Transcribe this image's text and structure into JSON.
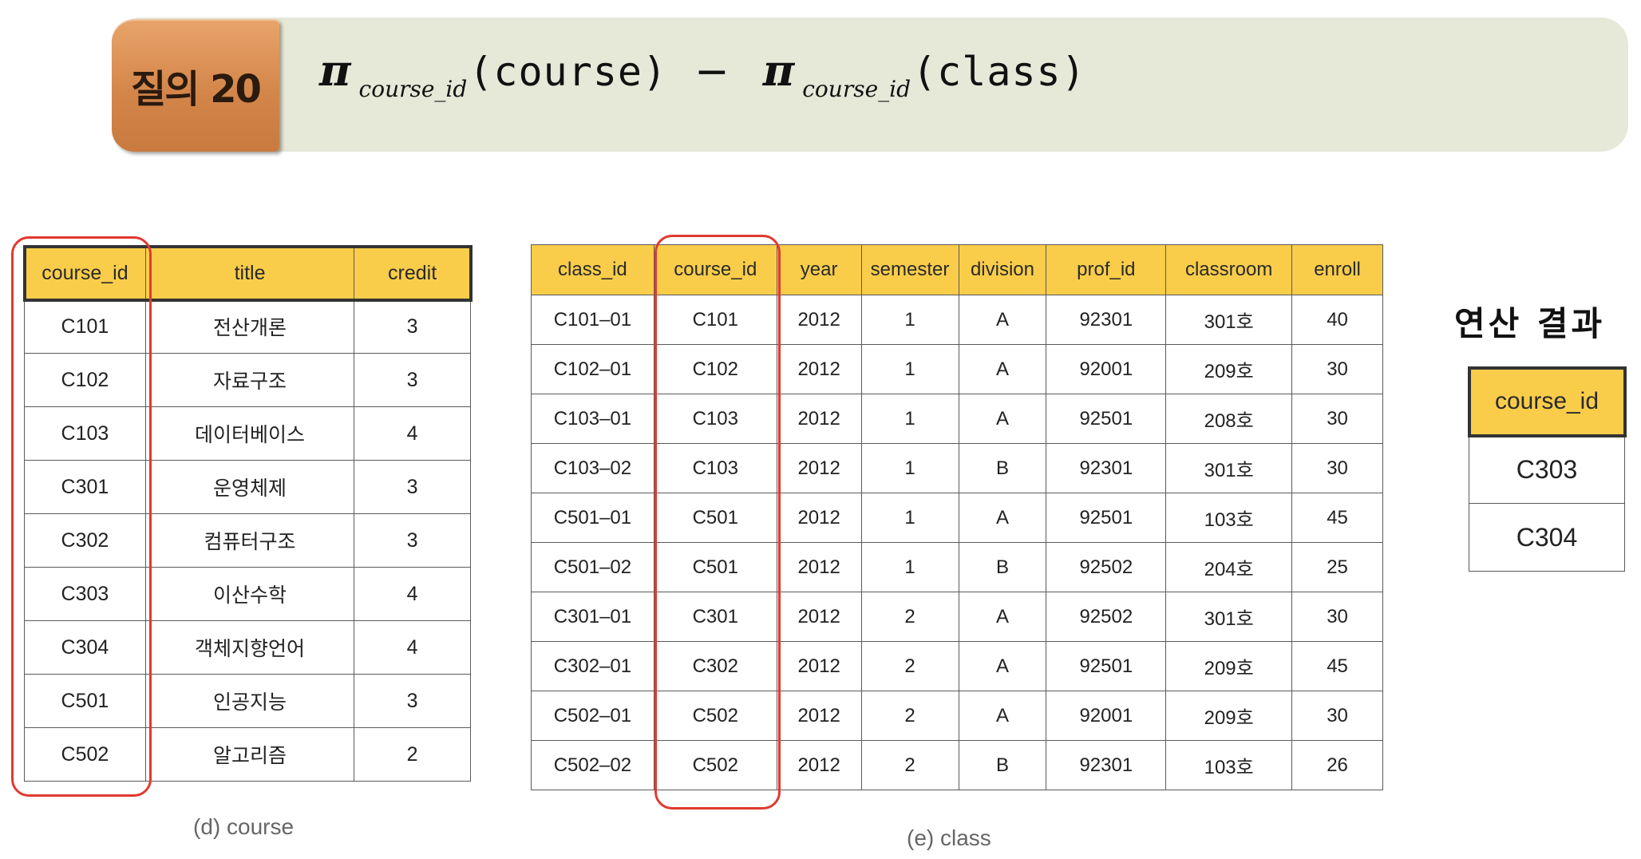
{
  "header": {
    "badge": "질의 20",
    "formula": {
      "op": "π",
      "attr": "course_id",
      "left_relation": "(course)",
      "minus": "−",
      "right_relation": "(class)"
    }
  },
  "course_table": {
    "headers": [
      "course_id",
      "title",
      "credit"
    ],
    "rows": [
      [
        "C101",
        "전산개론",
        "3"
      ],
      [
        "C102",
        "자료구조",
        "3"
      ],
      [
        "C103",
        "데이터베이스",
        "4"
      ],
      [
        "C301",
        "운영체제",
        "3"
      ],
      [
        "C302",
        "컴퓨터구조",
        "3"
      ],
      [
        "C303",
        "이산수학",
        "4"
      ],
      [
        "C304",
        "객체지향언어",
        "4"
      ],
      [
        "C501",
        "인공지능",
        "3"
      ],
      [
        "C502",
        "알고리즘",
        "2"
      ]
    ],
    "caption": "(d) course"
  },
  "class_table": {
    "headers": [
      "class_id",
      "course_id",
      "year",
      "semester",
      "division",
      "prof_id",
      "classroom",
      "enroll"
    ],
    "rows": [
      [
        "C101–01",
        "C101",
        "2012",
        "1",
        "A",
        "92301",
        "301호",
        "40"
      ],
      [
        "C102–01",
        "C102",
        "2012",
        "1",
        "A",
        "92001",
        "209호",
        "30"
      ],
      [
        "C103–01",
        "C103",
        "2012",
        "1",
        "A",
        "92501",
        "208호",
        "30"
      ],
      [
        "C103–02",
        "C103",
        "2012",
        "1",
        "B",
        "92301",
        "301호",
        "30"
      ],
      [
        "C501–01",
        "C501",
        "2012",
        "1",
        "A",
        "92501",
        "103호",
        "45"
      ],
      [
        "C501–02",
        "C501",
        "2012",
        "1",
        "B",
        "92502",
        "204호",
        "25"
      ],
      [
        "C301–01",
        "C301",
        "2012",
        "2",
        "A",
        "92502",
        "301호",
        "30"
      ],
      [
        "C302–01",
        "C302",
        "2012",
        "2",
        "A",
        "92501",
        "209호",
        "45"
      ],
      [
        "C502–01",
        "C502",
        "2012",
        "2",
        "A",
        "92001",
        "209호",
        "30"
      ],
      [
        "C502–02",
        "C502",
        "2012",
        "2",
        "B",
        "92301",
        "103호",
        "26"
      ]
    ],
    "caption": "(e) class"
  },
  "result": {
    "title": "연산 결과",
    "headers": [
      "course_id"
    ],
    "rows": [
      [
        "C303"
      ],
      [
        "C304"
      ]
    ]
  },
  "colors": {
    "header_fill": "#f9cd4a",
    "highlight": "#e03a2f",
    "badge": "#d4864a",
    "banner": "#e6e8d8"
  }
}
